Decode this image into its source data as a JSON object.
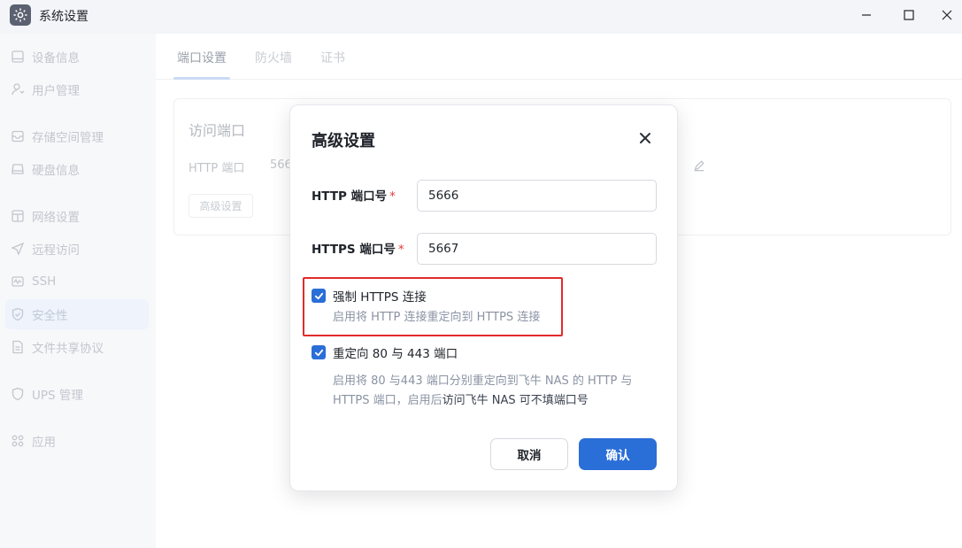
{
  "window": {
    "title": "系统设置"
  },
  "sidebar": {
    "items": [
      {
        "label": "设备信息",
        "icon": "device-icon"
      },
      {
        "label": "用户管理",
        "icon": "user-icon"
      },
      {
        "label": "存储空间管理",
        "icon": "storage-icon"
      },
      {
        "label": "硬盘信息",
        "icon": "disk-icon"
      },
      {
        "label": "网络设置",
        "icon": "network-icon"
      },
      {
        "label": "远程访问",
        "icon": "remote-icon"
      },
      {
        "label": "SSH",
        "icon": "ssh-icon"
      },
      {
        "label": "安全性",
        "icon": "shield-icon"
      },
      {
        "label": "文件共享协议",
        "icon": "file-share-icon"
      },
      {
        "label": "UPS 管理",
        "icon": "ups-icon"
      },
      {
        "label": "应用",
        "icon": "apps-icon"
      }
    ],
    "active": "安全性"
  },
  "tabs": [
    {
      "label": "端口设置"
    },
    {
      "label": "防火墙"
    },
    {
      "label": "证书"
    }
  ],
  "card": {
    "title": "访问端口",
    "http_label": "HTTP 端口",
    "http_value": "566",
    "advanced_button": "高级设置"
  },
  "modal": {
    "title": "高级设置",
    "http_port_label": "HTTP 端口号",
    "http_port_value": "5666",
    "https_port_label": "HTTPS 端口号",
    "https_port_value": "5667",
    "required_mark": "*",
    "force_https": {
      "label": "强制 HTTPS 连接",
      "checked": true,
      "desc": "启用将 HTTP 连接重定向到 HTTPS 连接"
    },
    "redirect_80_443": {
      "label": "重定向 80 与 443 端口",
      "checked": true,
      "desc_line1": "启用将 80 与443 端口分别重定向到飞牛 NAS 的 HTTP 与",
      "desc_line2a": "HTTPS 端口，启用后",
      "desc_line2b": "访问飞牛 NAS 可不填端口号"
    },
    "cancel_button": "取消",
    "confirm_button": "确认"
  },
  "colors": {
    "accent": "#2a6ed8",
    "highlight": "#e22b2b"
  }
}
